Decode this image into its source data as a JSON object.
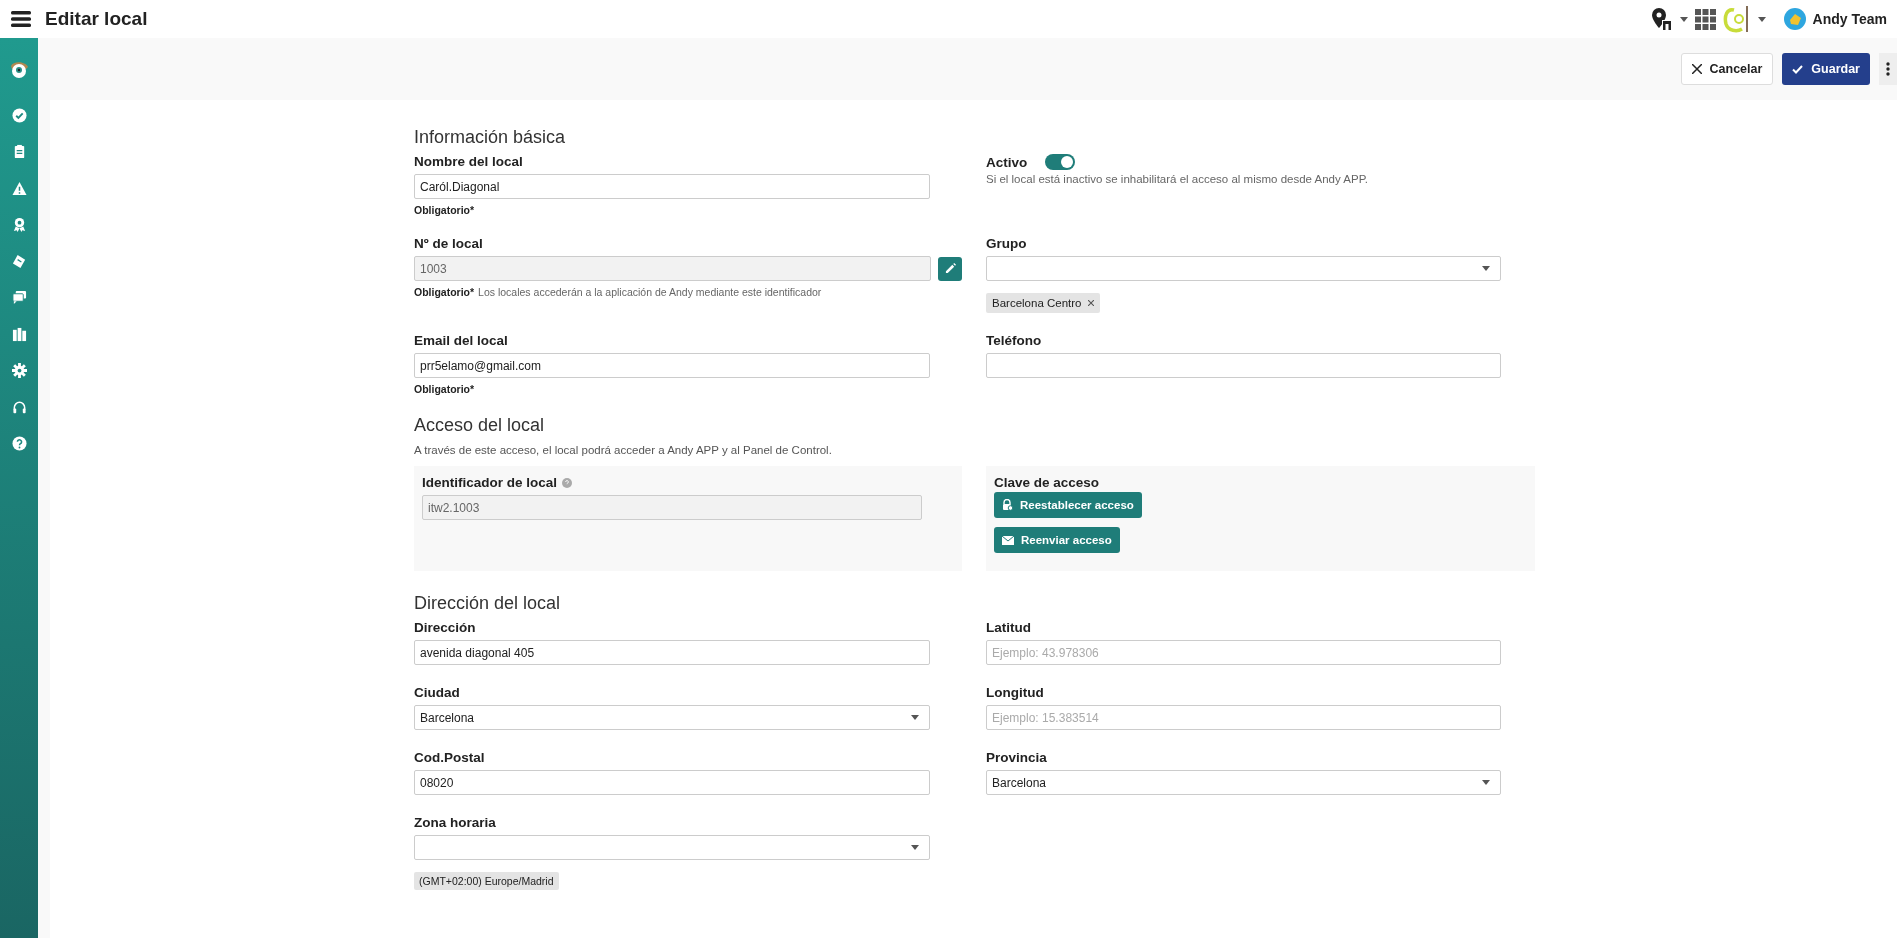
{
  "header": {
    "title": "Editar local",
    "user_name": "Andy Team"
  },
  "actions": {
    "cancel": "Cancelar",
    "save": "Guardar"
  },
  "sections": [
    {
      "kind": "grid",
      "title": "Información básica",
      "rows": [
        [
          {
            "kind": "text",
            "label": "Nombre del local",
            "value": "Caról.Diagonal",
            "required_note": "Obligatorio*"
          },
          {
            "kind": "toggle",
            "label": "Activo",
            "on": true,
            "description": "Si el local está inactivo se inhabilitará el acceso al mismo desde Andy APP."
          }
        ],
        [
          {
            "kind": "locked",
            "label": "Nº de local",
            "value": "1003",
            "required_note": "Obligatorio*",
            "help": "Los locales accederán a la aplicación de Andy mediante este identificador"
          },
          {
            "kind": "select",
            "label": "Grupo",
            "tags": [
              {
                "text": "Barcelona Centro",
                "removable": true
              }
            ]
          }
        ],
        [
          {
            "kind": "text",
            "label": "Email del local",
            "value": "prr5elamo@gmail.com",
            "required_note": "Obligatorio*"
          },
          {
            "kind": "text",
            "label": "Teléfono"
          }
        ]
      ]
    },
    {
      "kind": "access",
      "title": "Acceso del local",
      "description": "A través de este acceso, el local podrá acceder a Andy APP y al Panel de Control.",
      "identifier": {
        "label": "Identificador de local",
        "value": "itw2.1003"
      },
      "key": {
        "label": "Clave de acceso",
        "buttons": [
          {
            "kind": "reset",
            "label": "Reestablecer acceso"
          },
          {
            "kind": "resend",
            "label": "Reenviar acceso"
          }
        ]
      }
    },
    {
      "kind": "grid",
      "title": "Dirección del local",
      "rows": [
        [
          {
            "kind": "text",
            "label": "Dirección",
            "value": "avenida diagonal 405"
          },
          {
            "kind": "text",
            "label": "Latitud",
            "placeholder": "Ejemplo: 43.978306"
          }
        ],
        [
          {
            "kind": "select",
            "label": "Ciudad",
            "value": "Barcelona"
          },
          {
            "kind": "text",
            "label": "Longitud",
            "placeholder": "Ejemplo: 15.383514"
          }
        ],
        [
          {
            "kind": "text",
            "label": "Cod.Postal",
            "value": "08020"
          },
          {
            "kind": "select",
            "label": "Provincia",
            "value": "Barcelona"
          }
        ],
        [
          {
            "kind": "select",
            "label": "Zona horaria",
            "tags": [
              {
                "text": "(GMT+02:00) Europe/Madrid",
                "removable": false
              }
            ]
          }
        ]
      ]
    }
  ]
}
